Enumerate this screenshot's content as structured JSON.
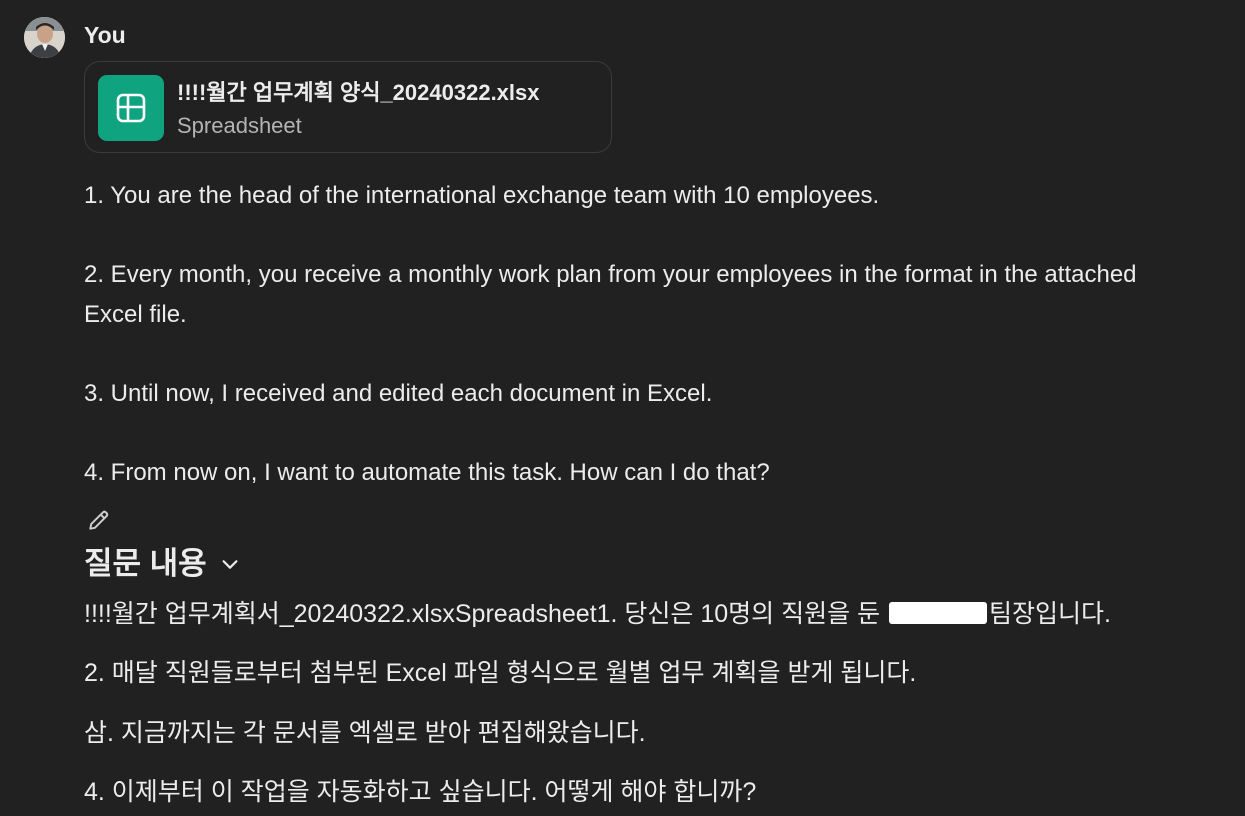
{
  "message": {
    "author": "You",
    "attachment": {
      "file_name": "!!!!월간 업무계획 양식_20240322.xlsx",
      "file_type": "Spreadsheet",
      "icon": "spreadsheet-icon",
      "icon_color": "#10a37f"
    },
    "paragraphs": [
      "1. You are the head of the international exchange team with 10 employees.",
      "2. Every month, you receive a monthly work plan from your employees in the format in the attached Excel file.",
      "3. Until now, I received and edited each document in Excel.",
      "4. From now on, I want to automate this task. How can I do that?"
    ],
    "edit_icon": "pencil-icon"
  },
  "translation": {
    "title": "질문 내용",
    "toggle_icon": "chevron-down-icon",
    "line1_before": "!!!!월간 업무계획서_20240322.xlsxSpreadsheet1. 당신은 10명의 직원을 둔 ",
    "line1_after": "팀장입니다.",
    "line2": "2. 매달 직원들로부터 첨부된 Excel 파일 형식으로 월별 업무 계획을 받게 됩니다.",
    "line3": "삼. 지금까지는 각 문서를 엑셀로 받아 편집해왔습니다.",
    "line4": "4. 이제부터 이 작업을 자동화하고 싶습니다. 어떻게 해야 합니까?"
  },
  "colors": {
    "background": "#212121",
    "text": "#ececec",
    "muted_text": "#b4b4b4",
    "card_border": "#3b3b3b"
  }
}
